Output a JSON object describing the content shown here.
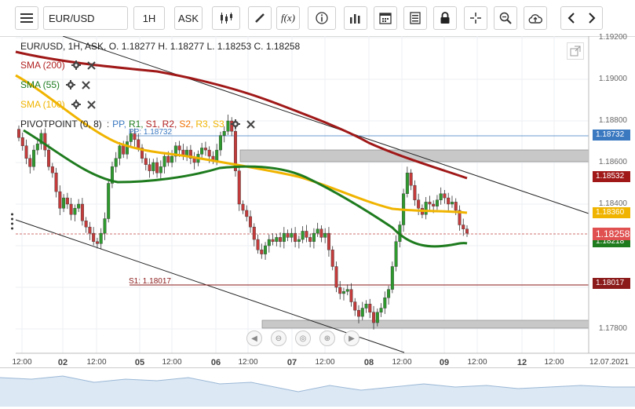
{
  "toolbar": {
    "symbol": "EUR/USD",
    "timeframe": "1H",
    "price_type": "ASK",
    "fx_label": "f(x)",
    "icons": [
      "menu-icon",
      "candles-icon",
      "draw-icon",
      "function-icon",
      "info-icon",
      "bars-icon",
      "calendar-icon",
      "list-icon",
      "lock-icon",
      "crosshair-icon",
      "zoom-icon",
      "cloud-upload-icon",
      "prev-icon",
      "next-icon"
    ]
  },
  "legend": {
    "ohlc": "EUR/USD, 1H, ASK,  O. 1.18277 H. 1.18277 L. 1.18253 C. 1.18258",
    "indicators": [
      {
        "label": "SMA (200)",
        "color": "#b22222"
      },
      {
        "label": "SMA (55)",
        "color": "#1e7b1e"
      },
      {
        "label": "SMA (100)",
        "color": "#f0b400"
      }
    ],
    "pivot": {
      "label": "PIVOTPOINT (0, 8)",
      "sep": ":",
      "items": [
        {
          "label": "PP,",
          "color": "#3a78c0"
        },
        {
          "label": "R1,",
          "color": "#1e7b1e"
        },
        {
          "label": "S1,",
          "color": "#b22222"
        },
        {
          "label": "R2,",
          "color": "#b22222"
        },
        {
          "label": "S2,",
          "color": "#f07000"
        },
        {
          "label": "R3,",
          "color": "#f0b400"
        },
        {
          "label": "S3",
          "color": "#f0b400"
        }
      ]
    }
  },
  "chart_data": {
    "type": "line",
    "title": "EUR/USD, 1H, ASK",
    "ylim": [
      1.1775,
      1.1925
    ],
    "y_ticks": [
      "1.19200",
      "1.19000",
      "1.18800",
      "1.18600",
      "1.18400",
      "1.18200",
      "1.18000",
      "1.17800"
    ],
    "x_ticks": [
      "12:00",
      "02",
      "12:00",
      "05",
      "12:00",
      "06",
      "12:00",
      "07",
      "12:00",
      "08",
      "12:00",
      "09",
      "12:00",
      "12",
      "12:00",
      "12.07.2021"
    ],
    "last_price": {
      "label": "1.18258",
      "value": 1.18258,
      "color": "#e05050"
    },
    "price_tags": [
      {
        "label": "1.18732",
        "value": 1.18732,
        "color": "#3a78c0"
      },
      {
        "label": "1.18532",
        "value": 1.18532,
        "color": "#a01818"
      },
      {
        "label": "1.18360",
        "value": 1.1836,
        "color": "#f0b400"
      },
      {
        "label": "1.18218",
        "value": 1.18218,
        "color": "#1e7b1e"
      },
      {
        "label": "1.18017",
        "value": 1.18017,
        "color": "#8b1a1a"
      }
    ],
    "pivot_lines": [
      {
        "label": "PP: 1.18732",
        "value": 1.18732,
        "color": "#3a78c0"
      },
      {
        "label": "S1: 1.18017",
        "value": 1.18017,
        "color": "#8b1a1a"
      }
    ],
    "candles_close": [
      1.1872,
      1.1868,
      1.1862,
      1.1858,
      1.1866,
      1.1869,
      1.1874,
      1.1866,
      1.1858,
      1.1855,
      1.1846,
      1.1838,
      1.1843,
      1.184,
      1.1835,
      1.1838,
      1.184,
      1.1832,
      1.1829,
      1.1826,
      1.1822,
      1.1821,
      1.1826,
      1.1833,
      1.185,
      1.1858,
      1.1862,
      1.1868,
      1.1864,
      1.187,
      1.1874,
      1.1871,
      1.1867,
      1.1862,
      1.1859,
      1.1856,
      1.186,
      1.1855,
      1.1858,
      1.1863,
      1.186,
      1.1863,
      1.1868,
      1.1866,
      1.1863,
      1.1866,
      1.1862,
      1.186,
      1.1864,
      1.1867,
      1.1866,
      1.1863,
      1.1861,
      1.1866,
      1.1873,
      1.1875,
      1.188,
      1.1875,
      1.1856,
      1.184,
      1.1837,
      1.1834,
      1.1829,
      1.1823,
      1.1818,
      1.1816,
      1.182,
      1.1823,
      1.1822,
      1.1824,
      1.1822,
      1.1826,
      1.1824,
      1.1826,
      1.1822,
      1.1823,
      1.1827,
      1.1824,
      1.1822,
      1.1826,
      1.1828,
      1.1824,
      1.1826,
      1.1818,
      1.181,
      1.18,
      1.1797,
      1.1798,
      1.1799,
      1.1793,
      1.1789,
      1.1786,
      1.179,
      1.1792,
      1.1788,
      1.1783,
      1.1788,
      1.179,
      1.1795,
      1.1799,
      1.181,
      1.1822,
      1.183,
      1.1845,
      1.1855,
      1.1849,
      1.1842,
      1.1838,
      1.1835,
      1.1841,
      1.184,
      1.1839,
      1.1842,
      1.1845,
      1.1843,
      1.184,
      1.1841,
      1.1837,
      1.183,
      1.1828,
      1.1826
    ],
    "sma200_end": 1.18532,
    "sma100_end": 1.1836,
    "sma55_end": 1.18218,
    "axis_labels": {
      "s1": "S1: 1.18017",
      "pp": "PP: 1.18732"
    }
  }
}
